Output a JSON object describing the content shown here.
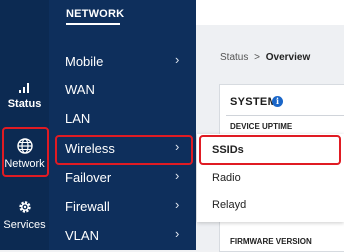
{
  "rail": {
    "items": [
      {
        "label": "Status",
        "icon": "signal-bars-icon"
      },
      {
        "label": "Network",
        "icon": "globe-icon"
      },
      {
        "label": "Services",
        "icon": "gear-icon"
      }
    ]
  },
  "nav": {
    "title": "NETWORK",
    "items": [
      {
        "label": "Mobile"
      },
      {
        "label": "WAN"
      },
      {
        "label": "LAN"
      },
      {
        "label": "Wireless"
      },
      {
        "label": "Failover"
      },
      {
        "label": "Firewall"
      },
      {
        "label": "VLAN"
      }
    ],
    "chevron": "›"
  },
  "breadcrumb": {
    "parent": "Status",
    "separator": ">",
    "current": "Overview"
  },
  "card": {
    "title": "SYSTEM",
    "info_glyph": "i",
    "device_uptime": "DEVICE UPTIME",
    "firmware_version": "FIRMWARE VERSION"
  },
  "submenu": {
    "items": [
      {
        "label": "SSIDs"
      },
      {
        "label": "Radio"
      },
      {
        "label": "Relayd"
      }
    ]
  },
  "colors": {
    "rail_bg": "#0c2a52",
    "nav_bg": "#0e2f5c",
    "highlight": "#e01b23",
    "accent": "#1a66c8"
  }
}
